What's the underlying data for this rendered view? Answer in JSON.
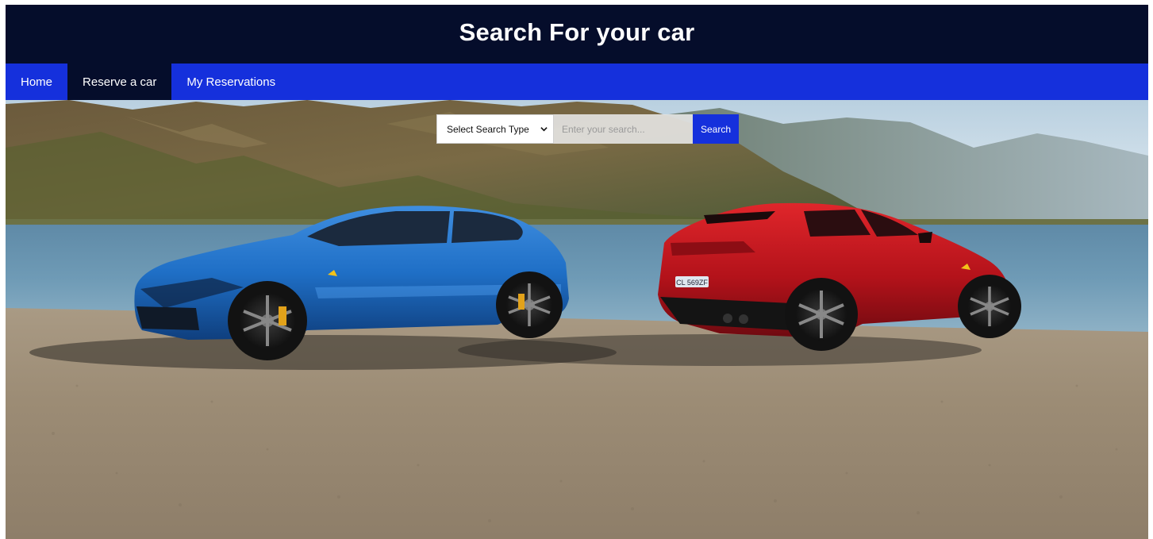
{
  "header": {
    "title": "Search For your car"
  },
  "nav": {
    "items": [
      {
        "label": "Home",
        "active": false
      },
      {
        "label": "Reserve a car",
        "active": true
      },
      {
        "label": "My Reservations",
        "active": false
      }
    ]
  },
  "search": {
    "type_selected": "Select Search Type",
    "placeholder": "Enter your search...",
    "value": "",
    "button_label": "Search"
  },
  "hero": {
    "image": "hero-photo-two-suvs-on-lakeshore",
    "car_left_color": "blue",
    "car_right_color": "red",
    "plate_text": "CL 569ZF"
  },
  "colors": {
    "header_bg": "#050d2b",
    "nav_bg": "#1530dc",
    "nav_active_bg": "#050d2b",
    "button_bg": "#1530dc"
  }
}
